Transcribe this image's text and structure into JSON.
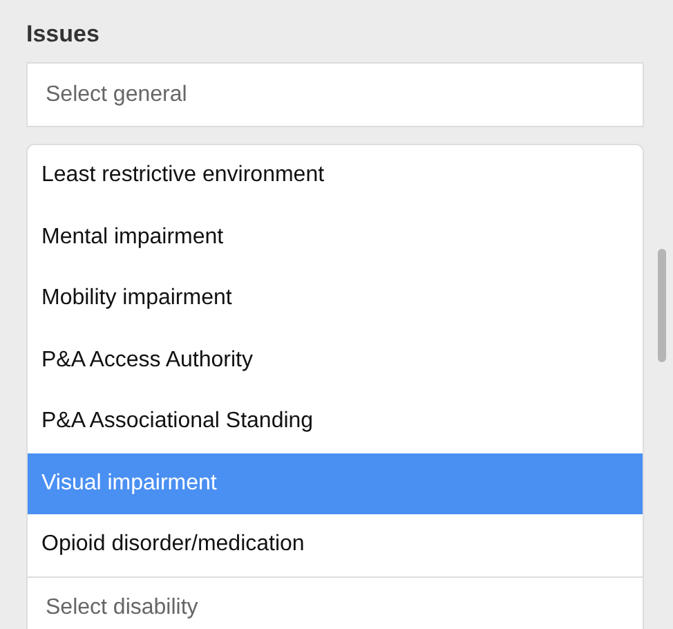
{
  "heading": "Issues",
  "general_select": {
    "placeholder": "Select general"
  },
  "options": [
    {
      "label": "Least restrictive environment",
      "selected": false
    },
    {
      "label": "Mental impairment",
      "selected": false
    },
    {
      "label": "Mobility impairment",
      "selected": false
    },
    {
      "label": "P&A Access Authority",
      "selected": false
    },
    {
      "label": "P&A Associational Standing",
      "selected": false
    },
    {
      "label": "Visual impairment",
      "selected": true
    },
    {
      "label": "Opioid disorder/medication",
      "selected": false
    }
  ],
  "disability_select": {
    "placeholder": "Select disability"
  }
}
